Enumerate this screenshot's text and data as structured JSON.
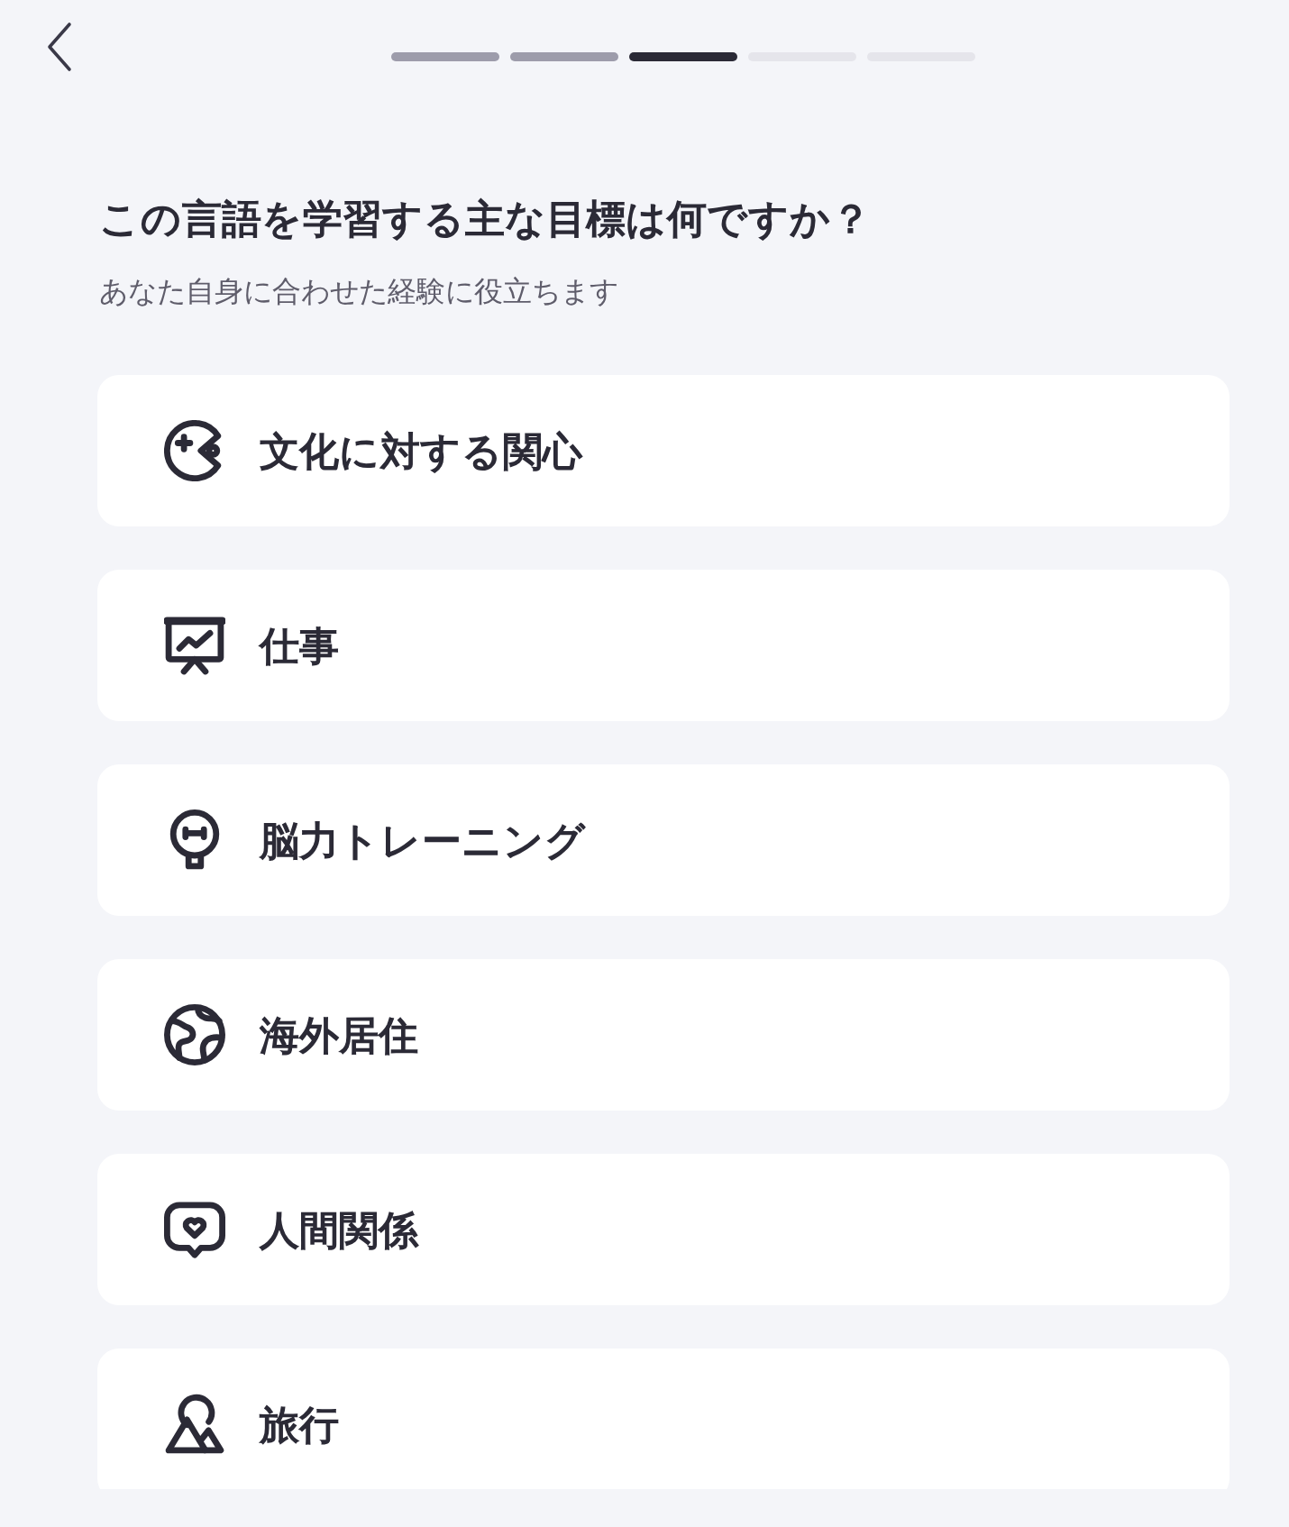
{
  "progress": {
    "steps": [
      {
        "completed": true,
        "current": false
      },
      {
        "completed": true,
        "current": false
      },
      {
        "completed": false,
        "current": true
      },
      {
        "completed": false,
        "current": false
      },
      {
        "completed": false,
        "current": false
      }
    ]
  },
  "heading": {
    "title": "この言語を学習する主な目標は何ですか？",
    "subtitle": "あなた自身に合わせた経験に役立ちます"
  },
  "options": [
    {
      "label": "文化に対する関心",
      "selected": false
    },
    {
      "label": "仕事",
      "selected": false
    },
    {
      "label": "脳力トレーニング",
      "selected": false
    },
    {
      "label": "海外居住",
      "selected": false
    },
    {
      "label": "人間関係",
      "selected": false
    },
    {
      "label": "旅行",
      "selected": false
    }
  ]
}
